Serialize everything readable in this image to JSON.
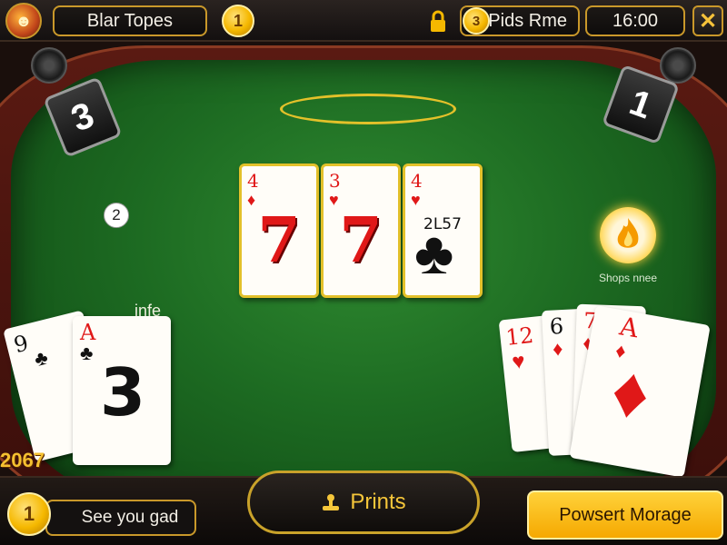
{
  "header": {
    "avatar_label": "☻",
    "title": "Blar Topes",
    "coin_value": "1",
    "player_coin": "3",
    "player_label": "Pids Rme",
    "timer": "16:00",
    "close_label": "✕"
  },
  "table": {
    "left_score": "3",
    "right_score": "1",
    "marker_badge": "2",
    "fire_label": "Shops nnee",
    "left_hand_label": "infe",
    "left_counter": "2067"
  },
  "center_cards": [
    {
      "rank": "4",
      "suit": "♦",
      "face": "7"
    },
    {
      "rank": "3",
      "suit": "♥",
      "face": "7"
    },
    {
      "rank": "4",
      "suit": "♥",
      "label": "2L57",
      "big_suit": "♣"
    }
  ],
  "left_hand": [
    {
      "rank": "9",
      "suit": "♣"
    },
    {
      "rank": "A",
      "suit": "♣",
      "face": "3"
    }
  ],
  "right_hand": [
    {
      "rank": "12",
      "suit": "♥"
    },
    {
      "rank": "6",
      "suit": "♦"
    },
    {
      "rank": "7",
      "suit": "♦"
    },
    {
      "rank": "A",
      "suit": "♦",
      "big_suit": "♦"
    }
  ],
  "footer": {
    "coin_value": "1",
    "message": "See you gad",
    "main_button": "Prints",
    "action_button": "Powsert Morage"
  },
  "colors": {
    "felt": "#1d6b22",
    "gold": "#c9982a",
    "accent_yellow": "#f5b800",
    "card_red": "#e01818"
  },
  "icons": [
    "avatar-icon",
    "coin-icon",
    "lock-icon",
    "close-icon",
    "speaker-icon",
    "fire-icon",
    "joystick-icon"
  ]
}
